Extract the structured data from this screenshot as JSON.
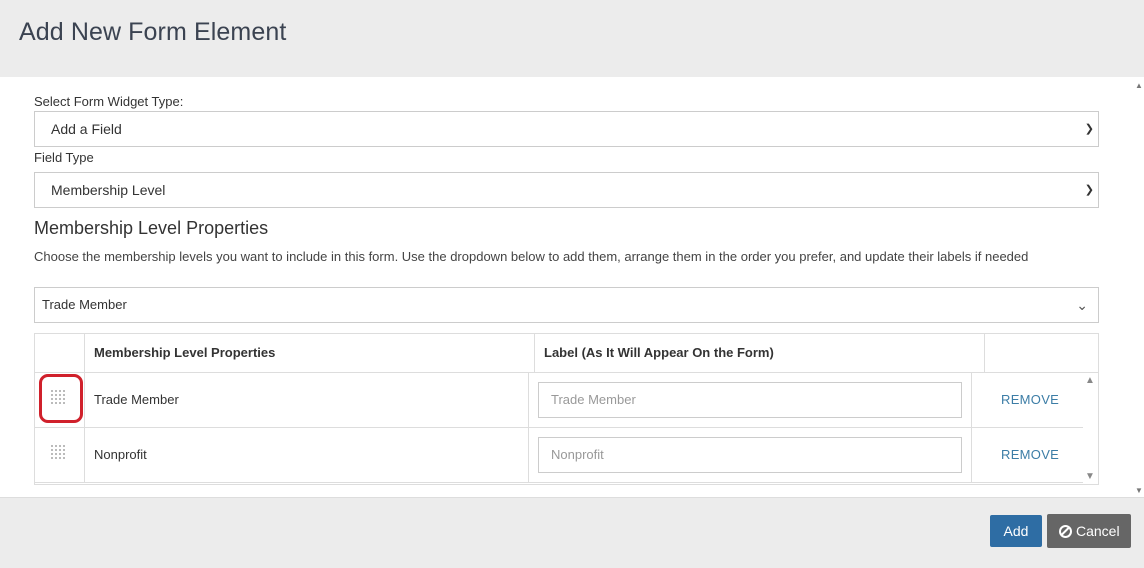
{
  "dialog": {
    "title": "Add New Form Element"
  },
  "widget_type": {
    "label": "Select Form Widget Type:",
    "value": "Add a Field"
  },
  "field_type": {
    "label": "Field Type",
    "value": "Membership Level"
  },
  "properties": {
    "title": "Membership Level Properties",
    "description": "Choose the membership levels you want to include in this form. Use the dropdown below to add them, arrange them in the order you prefer, and update their labels if needed",
    "dropdown_value": "Trade Member"
  },
  "table": {
    "headers": [
      "",
      "Membership Level Properties",
      "Label (As It Will Appear On the Form)",
      ""
    ],
    "rows": [
      {
        "name": "Trade Member",
        "label_placeholder": "Trade Member",
        "remove": "REMOVE"
      },
      {
        "name": "Nonprofit",
        "label_placeholder": "Nonprofit",
        "remove": "REMOVE"
      }
    ]
  },
  "footer": {
    "add_label": "Add",
    "cancel_label": "Cancel"
  },
  "icons": {
    "drag": "drag-handle-icon",
    "cancel": "ban-icon",
    "dropdown": "chevron-down-icon"
  },
  "colors": {
    "primary": "#2e6da4",
    "cancel": "#666666",
    "link": "#3c7da6",
    "highlight": "#d0202b"
  }
}
